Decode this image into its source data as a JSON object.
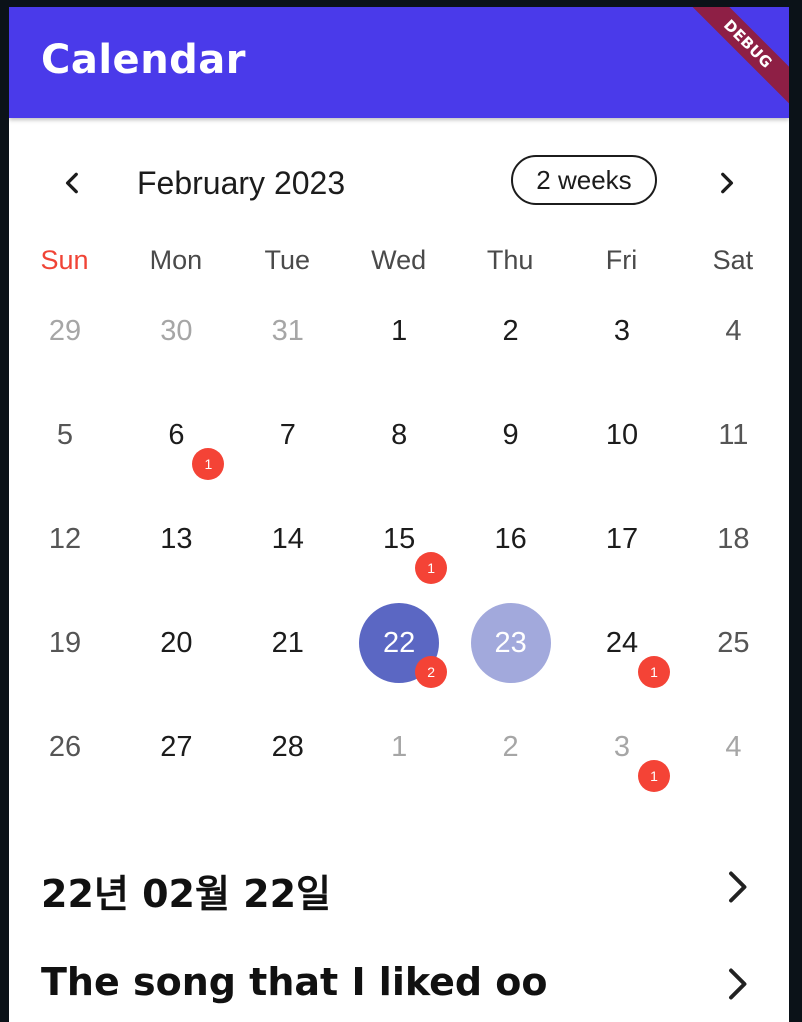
{
  "app_bar": {
    "title": "Calendar",
    "debug_label": "DEBUG"
  },
  "header": {
    "month_title": "February 2023",
    "format_button": "2 weeks"
  },
  "weekdays": [
    "Sun",
    "Mon",
    "Tue",
    "Wed",
    "Thu",
    "Fri",
    "Sat"
  ],
  "weeks": [
    [
      {
        "label": "29",
        "outside": true
      },
      {
        "label": "30",
        "outside": true
      },
      {
        "label": "31",
        "outside": true
      },
      {
        "label": "1"
      },
      {
        "label": "2"
      },
      {
        "label": "3"
      },
      {
        "label": "4"
      }
    ],
    [
      {
        "label": "5"
      },
      {
        "label": "6",
        "badge": "1"
      },
      {
        "label": "7"
      },
      {
        "label": "8"
      },
      {
        "label": "9"
      },
      {
        "label": "10"
      },
      {
        "label": "11"
      }
    ],
    [
      {
        "label": "12"
      },
      {
        "label": "13"
      },
      {
        "label": "14"
      },
      {
        "label": "15",
        "badge": "1"
      },
      {
        "label": "16"
      },
      {
        "label": "17"
      },
      {
        "label": "18"
      }
    ],
    [
      {
        "label": "19"
      },
      {
        "label": "20"
      },
      {
        "label": "21"
      },
      {
        "label": "22",
        "selected": true,
        "badge": "2"
      },
      {
        "label": "23",
        "today": true
      },
      {
        "label": "24",
        "badge": "1"
      },
      {
        "label": "25"
      }
    ],
    [
      {
        "label": "26"
      },
      {
        "label": "27"
      },
      {
        "label": "28"
      },
      {
        "label": "1",
        "outside": true
      },
      {
        "label": "2",
        "outside": true
      },
      {
        "label": "3",
        "outside": true,
        "badge": "1"
      },
      {
        "label": "4",
        "outside": true
      }
    ]
  ],
  "events": [
    {
      "title": "22년 02월 22일"
    },
    {
      "title": "The song that I liked oo"
    }
  ],
  "colors": {
    "app_bar": "#4a3aea",
    "selected_day": "#5b67c3",
    "today": "#a2a9dc",
    "badge": "#f44336",
    "sunday": "#f04436",
    "debug_banner": "#8e1f45"
  },
  "icons": {
    "prev": "chevron-left-icon",
    "next": "chevron-right-icon",
    "event_open": "chevron-right-icon"
  }
}
